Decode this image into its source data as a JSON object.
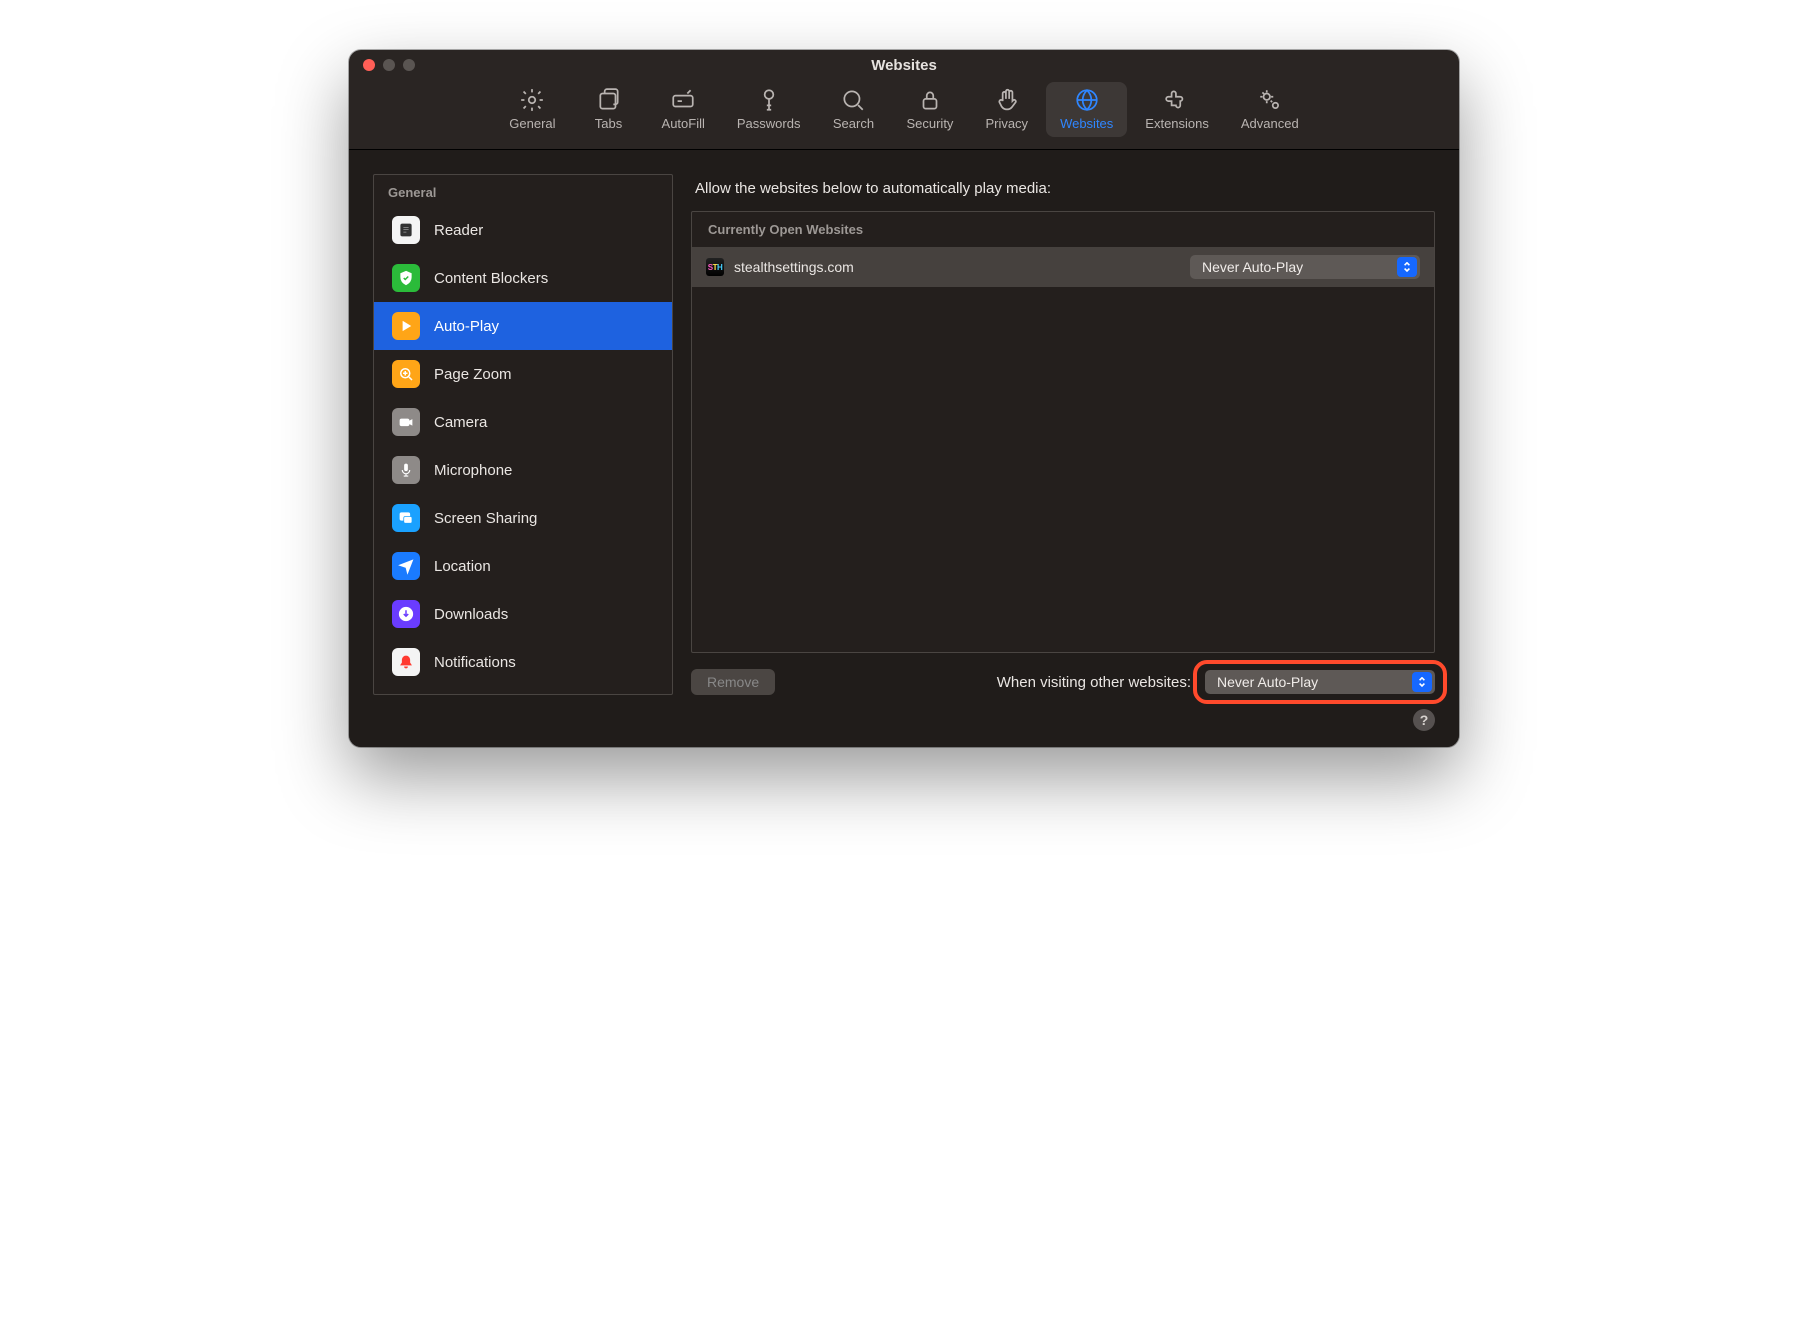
{
  "window": {
    "title": "Websites"
  },
  "toolbar": {
    "items": [
      {
        "label": "General"
      },
      {
        "label": "Tabs"
      },
      {
        "label": "AutoFill"
      },
      {
        "label": "Passwords"
      },
      {
        "label": "Search"
      },
      {
        "label": "Security"
      },
      {
        "label": "Privacy"
      },
      {
        "label": "Websites"
      },
      {
        "label": "Extensions"
      },
      {
        "label": "Advanced"
      }
    ],
    "active_index": 7
  },
  "sidebar": {
    "header": "General",
    "items": [
      {
        "label": "Reader"
      },
      {
        "label": "Content Blockers"
      },
      {
        "label": "Auto-Play"
      },
      {
        "label": "Page Zoom"
      },
      {
        "label": "Camera"
      },
      {
        "label": "Microphone"
      },
      {
        "label": "Screen Sharing"
      },
      {
        "label": "Location"
      },
      {
        "label": "Downloads"
      },
      {
        "label": "Notifications"
      }
    ],
    "selected_index": 2
  },
  "main": {
    "title": "Allow the websites below to automatically play media:",
    "list_header": "Currently Open Websites",
    "rows": [
      {
        "site": "stealthsettings.com",
        "favicon": "STH",
        "value": "Never Auto-Play"
      }
    ],
    "remove_label": "Remove",
    "footer_label": "When visiting other websites:",
    "footer_value": "Never Auto-Play"
  },
  "help": "?"
}
